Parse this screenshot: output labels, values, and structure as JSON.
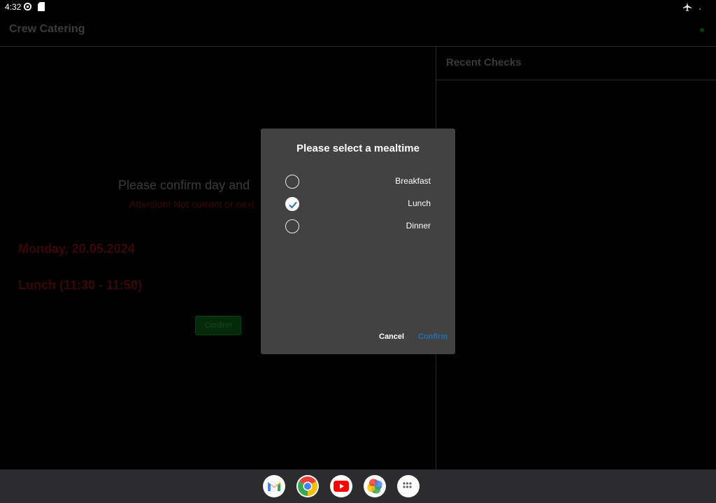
{
  "status_bar": {
    "time": "4:32"
  },
  "app": {
    "title": "Crew Catering",
    "main": {
      "prompt": "Please confirm day and",
      "attention": "Attention! Not current or next",
      "date": "Monday, 20.05.2024",
      "meal": "Lunch (11:30 - 11:50)",
      "confirm_label": "Confirm"
    },
    "recent_checks_title": "Recent Checks"
  },
  "dialog": {
    "title": "Please select a mealtime",
    "options": [
      {
        "label": "Breakfast",
        "checked": false
      },
      {
        "label": "Lunch",
        "checked": true
      },
      {
        "label": "Dinner",
        "checked": false
      }
    ],
    "cancel_label": "Cancel",
    "confirm_label": "Confirm",
    "confirm_color": "#1f6fb3"
  },
  "taskbar": {
    "apps": [
      "gmail-icon",
      "chrome-icon",
      "youtube-icon",
      "photos-icon",
      "app-drawer-icon"
    ]
  }
}
